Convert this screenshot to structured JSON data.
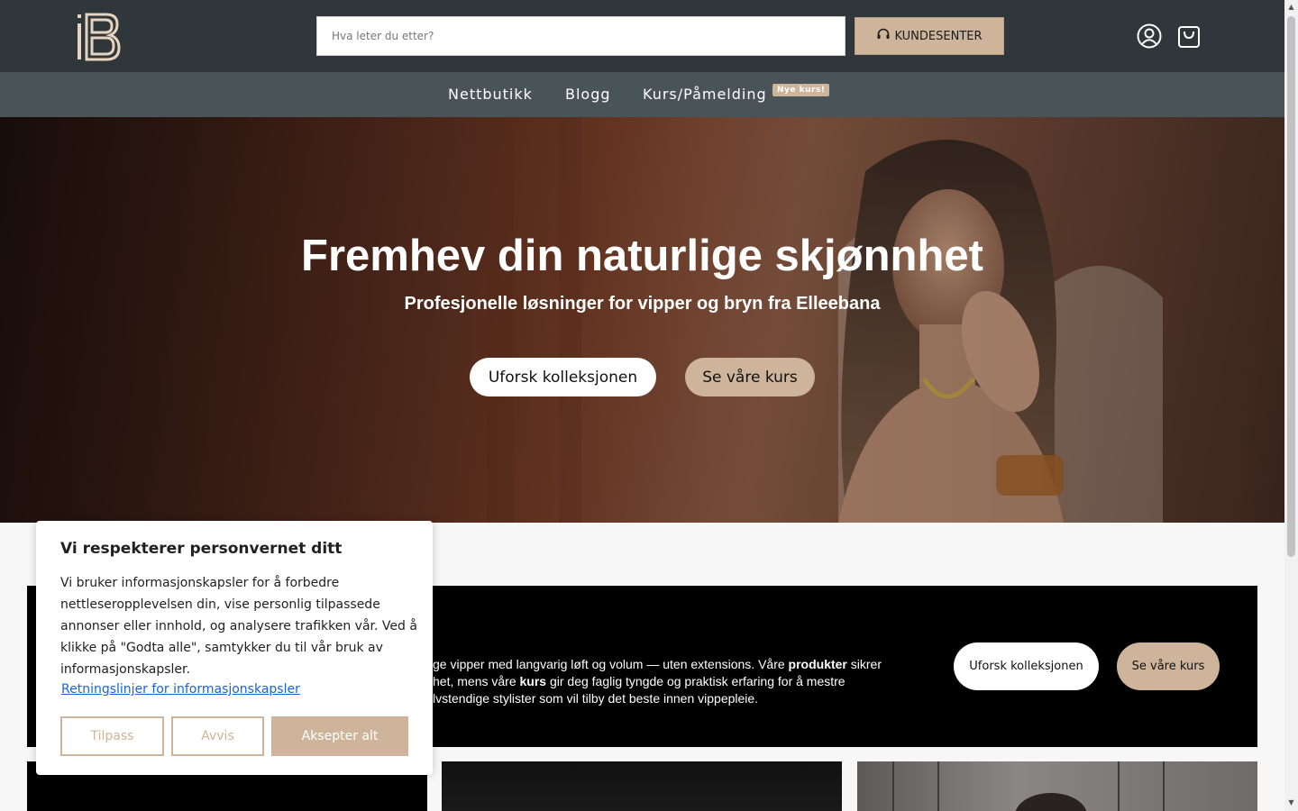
{
  "header": {
    "logo_text": "IB",
    "search_placeholder": "Hva leter du etter?",
    "kundesenter_label": "KUNDESENTER",
    "icons": [
      "headset-icon",
      "user-icon",
      "cart-icon"
    ]
  },
  "nav": {
    "items": [
      {
        "label": "Nettbutikk"
      },
      {
        "label": "Blogg"
      },
      {
        "label": "Kurs/Påmelding",
        "badge": "Nye kurs!"
      }
    ]
  },
  "hero": {
    "title": "Fremhev din naturlige skjønnhet",
    "subtitle": "Profesjonelle løsninger for vipper og bryn fra Elleebana",
    "primary_button": "Uforsk kolleksjonen",
    "secondary_button": "Se våre kurs"
  },
  "band": {
    "text_lines": [
      [
        "ge vipper med langvarig løft og volum — uten extensions. Våre ",
        "produkter",
        " sikrer"
      ],
      [
        "het, mens våre ",
        "kurs",
        " gir deg faglig tyngde og praktisk erfaring for å mestre"
      ],
      [
        "lvstendige stylister som vil tilby det beste innen vippepleie.",
        "",
        ""
      ]
    ],
    "primary_button": "Uforsk kolleksjonen",
    "secondary_button": "Se våre kurs"
  },
  "cookie": {
    "title": "Vi respekterer personvernet ditt",
    "body": "Vi bruker informasjonskapsler for å forbedre nettleseropplevelsen din, vise personlig tilpassede annonser eller innhold, og analysere trafikken vår. Ved å klikke på \"Godta alle\", samtykker du til vår bruk av informasjonskapsler.",
    "policy_link": "Retningslinjer for informasjonskapsler",
    "customize_label": "Tilpass",
    "reject_label": "Avvis",
    "accept_label": "Aksepter alt"
  },
  "colors": {
    "header_bg": "#2f373b",
    "nav_bg": "#4a5358",
    "accent": "#cdb49a",
    "link": "#1863dc"
  }
}
